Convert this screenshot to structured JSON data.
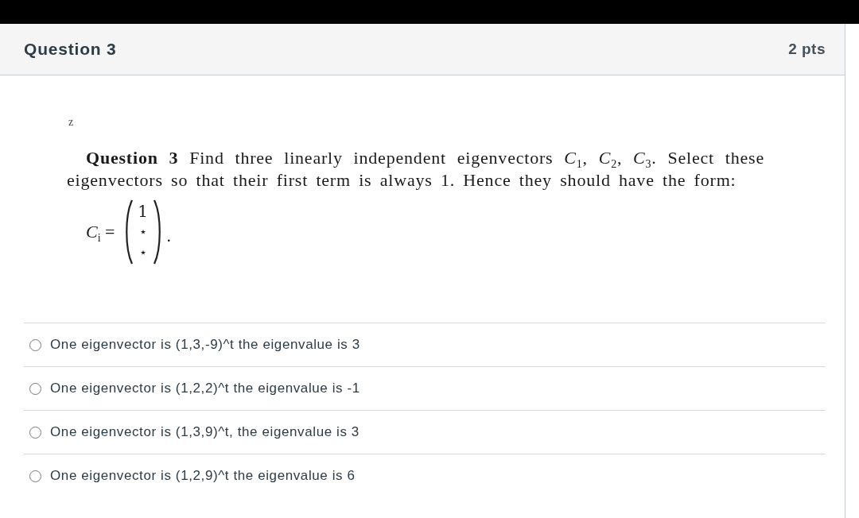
{
  "question": {
    "title": "Question 3",
    "points": "2 pts"
  },
  "body": {
    "mark": "z",
    "text": "**Question 3** Find three linearly independent eigenvectors *C*$_{1}$, *C*$_{2}$, *C*$_{3}$. Select these eigenvectors so that their first term is always 1. Hence they should have the form:",
    "formula": {
      "lhs": "*C*$_{i}$ =",
      "entries": [
        "1",
        "⋆",
        "⋆"
      ],
      "end": "."
    }
  },
  "answers": [
    {
      "label": "One eigenvector is (1,3,-9)^t the eigenvalue is 3",
      "selected": false
    },
    {
      "label": "One eigenvector is (1,2,2)^t the eigenvalue is -1",
      "selected": false
    },
    {
      "label": "One eigenvector is (1,3,9)^t, the eigenvalue is 3",
      "selected": false
    },
    {
      "label": "One eigenvector is (1,2,9)^t the eigenvalue is 6",
      "selected": false
    }
  ]
}
